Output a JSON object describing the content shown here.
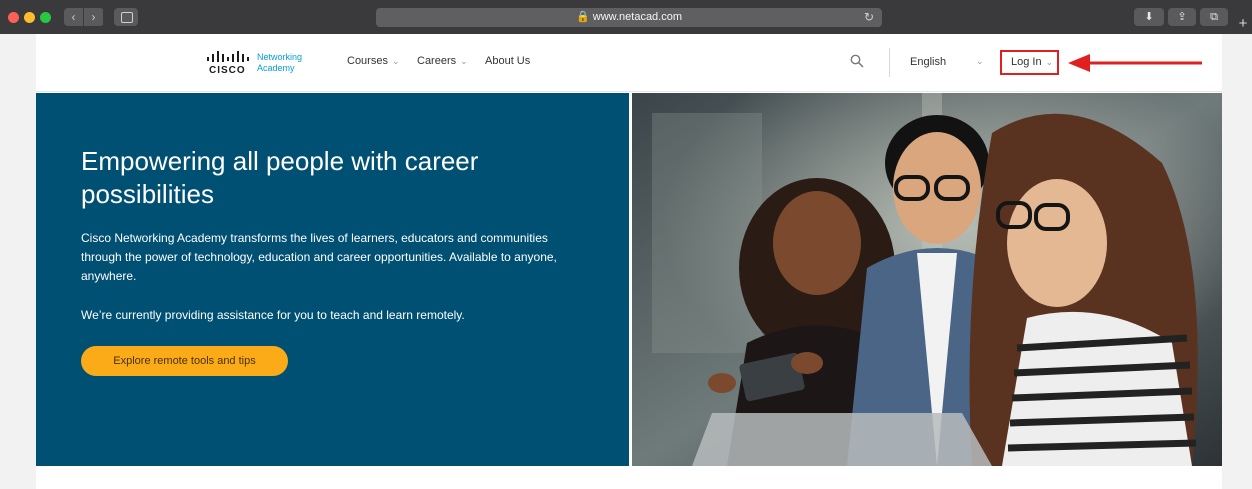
{
  "browser": {
    "url": "www.netacad.com",
    "back_icon": "chevron-left-icon",
    "forward_icon": "chevron-right-icon",
    "reload_icon": "reload-icon"
  },
  "logo": {
    "brand": "CISCO",
    "product_line1": "Networking",
    "product_line2": "Academy"
  },
  "nav": {
    "items": [
      {
        "label": "Courses",
        "has_caret": true
      },
      {
        "label": "Careers",
        "has_caret": true
      },
      {
        "label": "About Us",
        "has_caret": false
      }
    ],
    "language": "English",
    "login": "Log In"
  },
  "hero": {
    "title": "Empowering all people with career possibilities",
    "paragraph1": "Cisco Networking Academy transforms the lives of learners, educators and communities through the power of technology, education and career opportunities. Available to anyone, anywhere.",
    "paragraph2": "We’re currently providing assistance for you to teach and learn remotely.",
    "cta": "Explore remote tools and tips"
  },
  "colors": {
    "hero_bg": "#005073",
    "cta_bg": "#fbab18",
    "annotation_red": "#e02020",
    "logo_blue": "#049fd9"
  }
}
